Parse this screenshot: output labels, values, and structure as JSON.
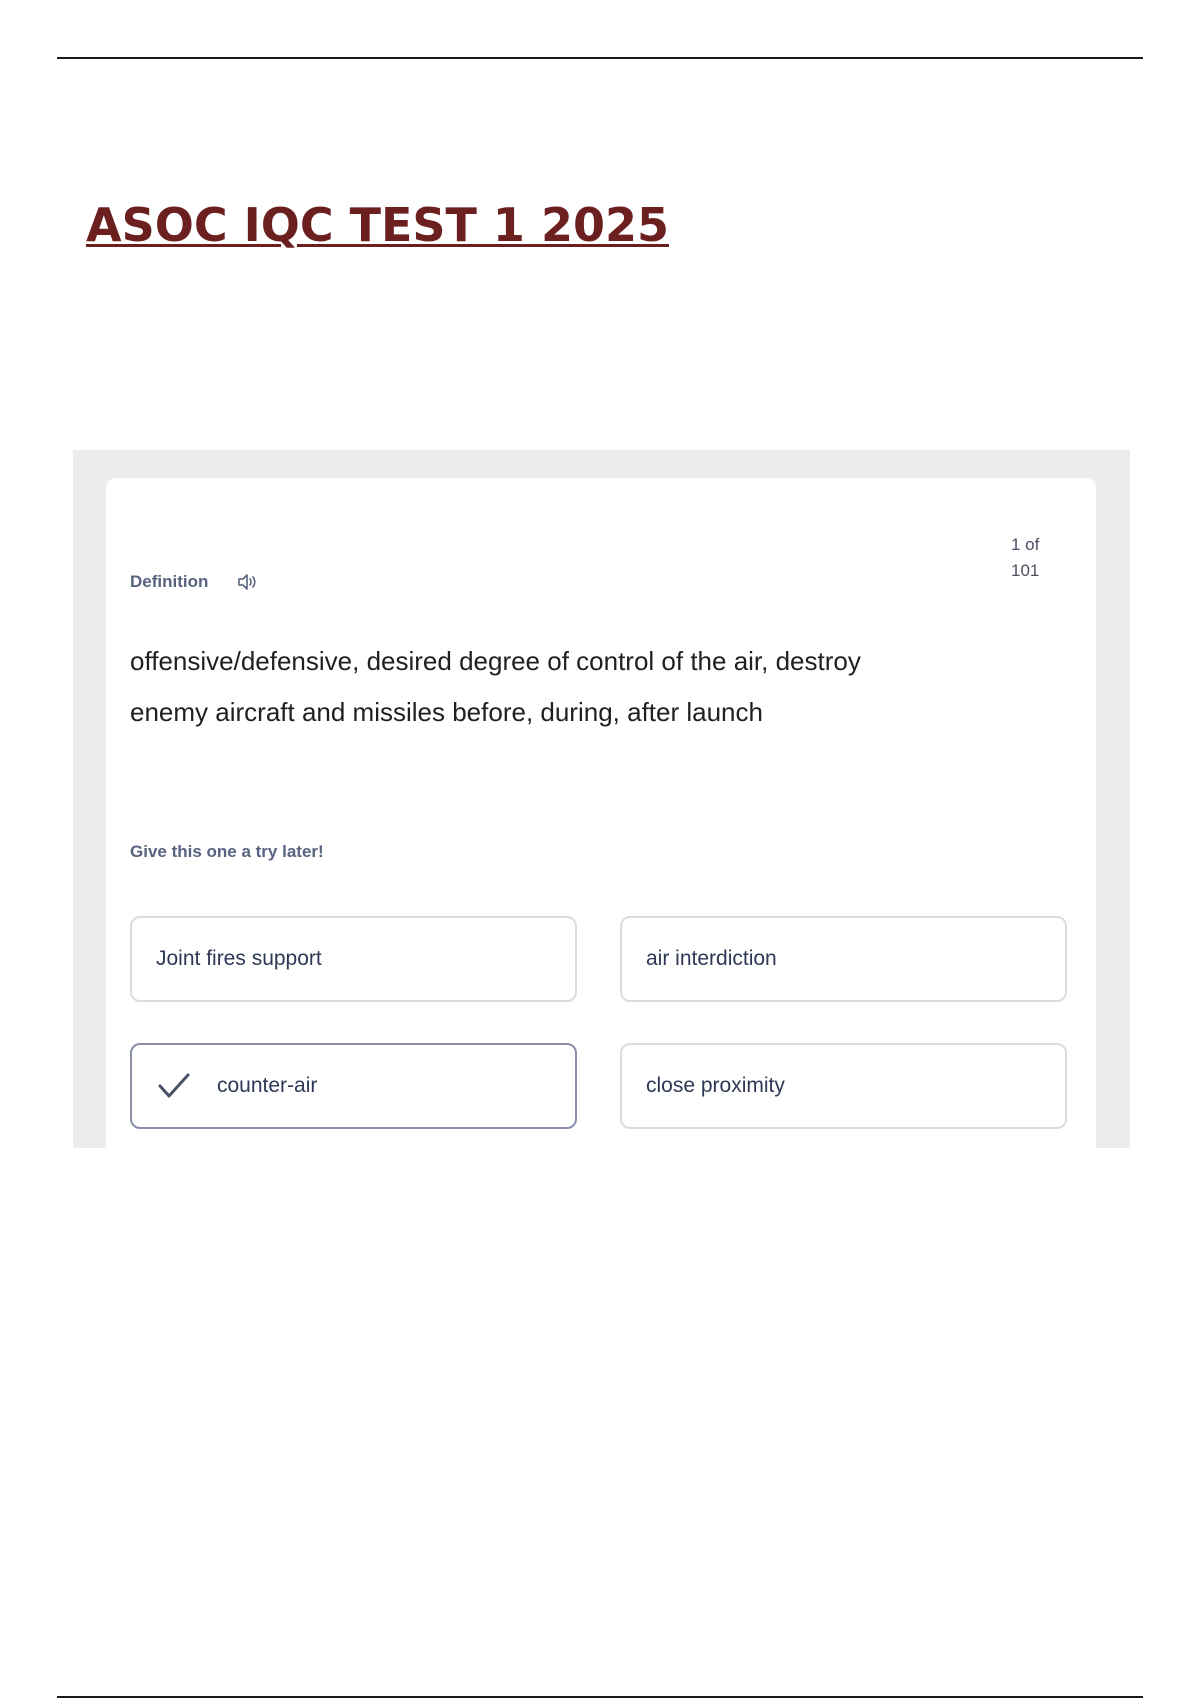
{
  "document": {
    "title": "ASOC IQC TEST 1 2025"
  },
  "card": {
    "counter_line1": "1 of",
    "counter_line2": "101",
    "term_label": "Definition",
    "speaker_icon": "speaker-icon",
    "definition_line1": "offensive/defensive, desired degree of control of the air, destroy",
    "definition_line2": "enemy aircraft and missiles before, during, after launch",
    "hint": "Give this one a try later!",
    "options": [
      {
        "label": "Joint fires support",
        "selected": false
      },
      {
        "label": "air interdiction",
        "selected": false
      },
      {
        "label": "counter-air",
        "selected": true,
        "icon": "checkmark-icon"
      },
      {
        "label": "close proximity",
        "selected": false
      }
    ]
  },
  "colors": {
    "title": "#6b1f1f",
    "label": "#586380",
    "selected_border": "#8a90a8",
    "frame_background": "#ececef"
  }
}
